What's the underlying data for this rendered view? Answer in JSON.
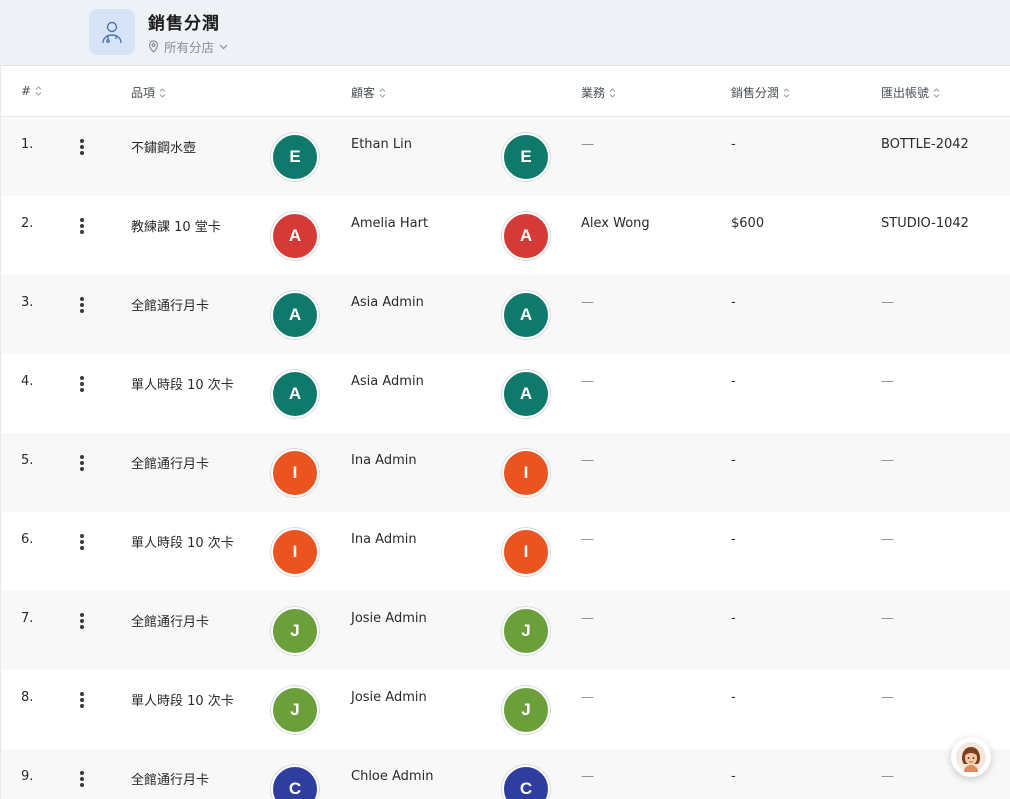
{
  "header": {
    "title": "銷售分潤",
    "branch": "所有分店",
    "icon": "doctor-avatar-icon"
  },
  "columns": {
    "index": "#",
    "item": "品項",
    "customer": "顧客",
    "sales": "業務",
    "commission": "銷售分潤",
    "export_account": "匯出帳號"
  },
  "rows": [
    {
      "index": "1.",
      "item": "不鏽鋼水壺",
      "customer": "Ethan Lin",
      "initial": "E",
      "color": "#0f7a6b",
      "sales": "—",
      "commission": "-",
      "export_account": "BOTTLE-2042"
    },
    {
      "index": "2.",
      "item": "教練課 10 堂卡",
      "customer": "Amelia Hart",
      "initial": "A",
      "color": "#d63a36",
      "sales": "Alex Wong",
      "commission": "$600",
      "export_account": "STUDIO-1042"
    },
    {
      "index": "3.",
      "item": "全館通行月卡",
      "customer": "Asia Admin",
      "initial": "A",
      "color": "#0f7a6b",
      "sales": "—",
      "commission": "-",
      "export_account": "—"
    },
    {
      "index": "4.",
      "item": "單人時段 10 次卡",
      "customer": "Asia Admin",
      "initial": "A",
      "color": "#0f7a6b",
      "sales": "—",
      "commission": "-",
      "export_account": "—"
    },
    {
      "index": "5.",
      "item": "全館通行月卡",
      "customer": "Ina Admin",
      "initial": "I",
      "color": "#ea5420",
      "sales": "—",
      "commission": "-",
      "export_account": "—"
    },
    {
      "index": "6.",
      "item": "單人時段 10 次卡",
      "customer": "Ina Admin",
      "initial": "I",
      "color": "#ea5420",
      "sales": "—",
      "commission": "-",
      "export_account": "—"
    },
    {
      "index": "7.",
      "item": "全館通行月卡",
      "customer": "Josie Admin",
      "initial": "J",
      "color": "#6a9f3a",
      "sales": "—",
      "commission": "-",
      "export_account": "—"
    },
    {
      "index": "8.",
      "item": "單人時段 10 次卡",
      "customer": "Josie Admin",
      "initial": "J",
      "color": "#6a9f3a",
      "sales": "—",
      "commission": "-",
      "export_account": "—"
    },
    {
      "index": "9.",
      "item": "全館通行月卡",
      "customer": "Chloe Admin",
      "initial": "C",
      "color": "#2f3e9e",
      "sales": "—",
      "commission": "-",
      "export_account": "—"
    }
  ],
  "chat": {
    "icon": "support-agent-avatar-icon"
  }
}
